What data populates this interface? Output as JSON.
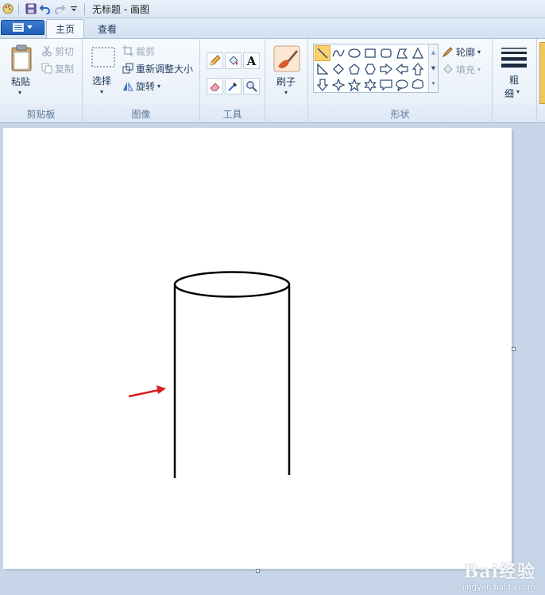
{
  "window": {
    "title": "无标题 - 画图"
  },
  "tabs": [
    {
      "label": "主页",
      "active": true
    },
    {
      "label": "查看",
      "active": false
    }
  ],
  "clipboard": {
    "paste_label": "粘贴",
    "cut_label": "剪切",
    "copy_label": "复制",
    "group_label": "剪贴板"
  },
  "image": {
    "select_label": "选择",
    "crop_label": "裁剪",
    "resize_label": "重新调整大小",
    "rotate_label": "旋转",
    "group_label": "图像"
  },
  "tools": {
    "group_label": "工具",
    "items": [
      "pencil-icon",
      "fill-bucket-icon",
      "text-icon",
      "eraser-icon",
      "color-picker-icon",
      "magnifier-icon"
    ],
    "text_glyph": "A"
  },
  "brush": {
    "label": "刷子"
  },
  "shapes": {
    "outline_label": "轮廓",
    "fill_label": "填充",
    "group_label": "形状",
    "selected": "line"
  },
  "size": {
    "label_line1": "粗",
    "label_line2": "细"
  },
  "watermark": {
    "logo": "Bai经验",
    "url": "jingyan.baidu.com"
  },
  "colors": {
    "accent": "#1f5fb8",
    "arrow": "#d62020",
    "stroke": "#000000",
    "selected_shape": "#fbd26b"
  }
}
